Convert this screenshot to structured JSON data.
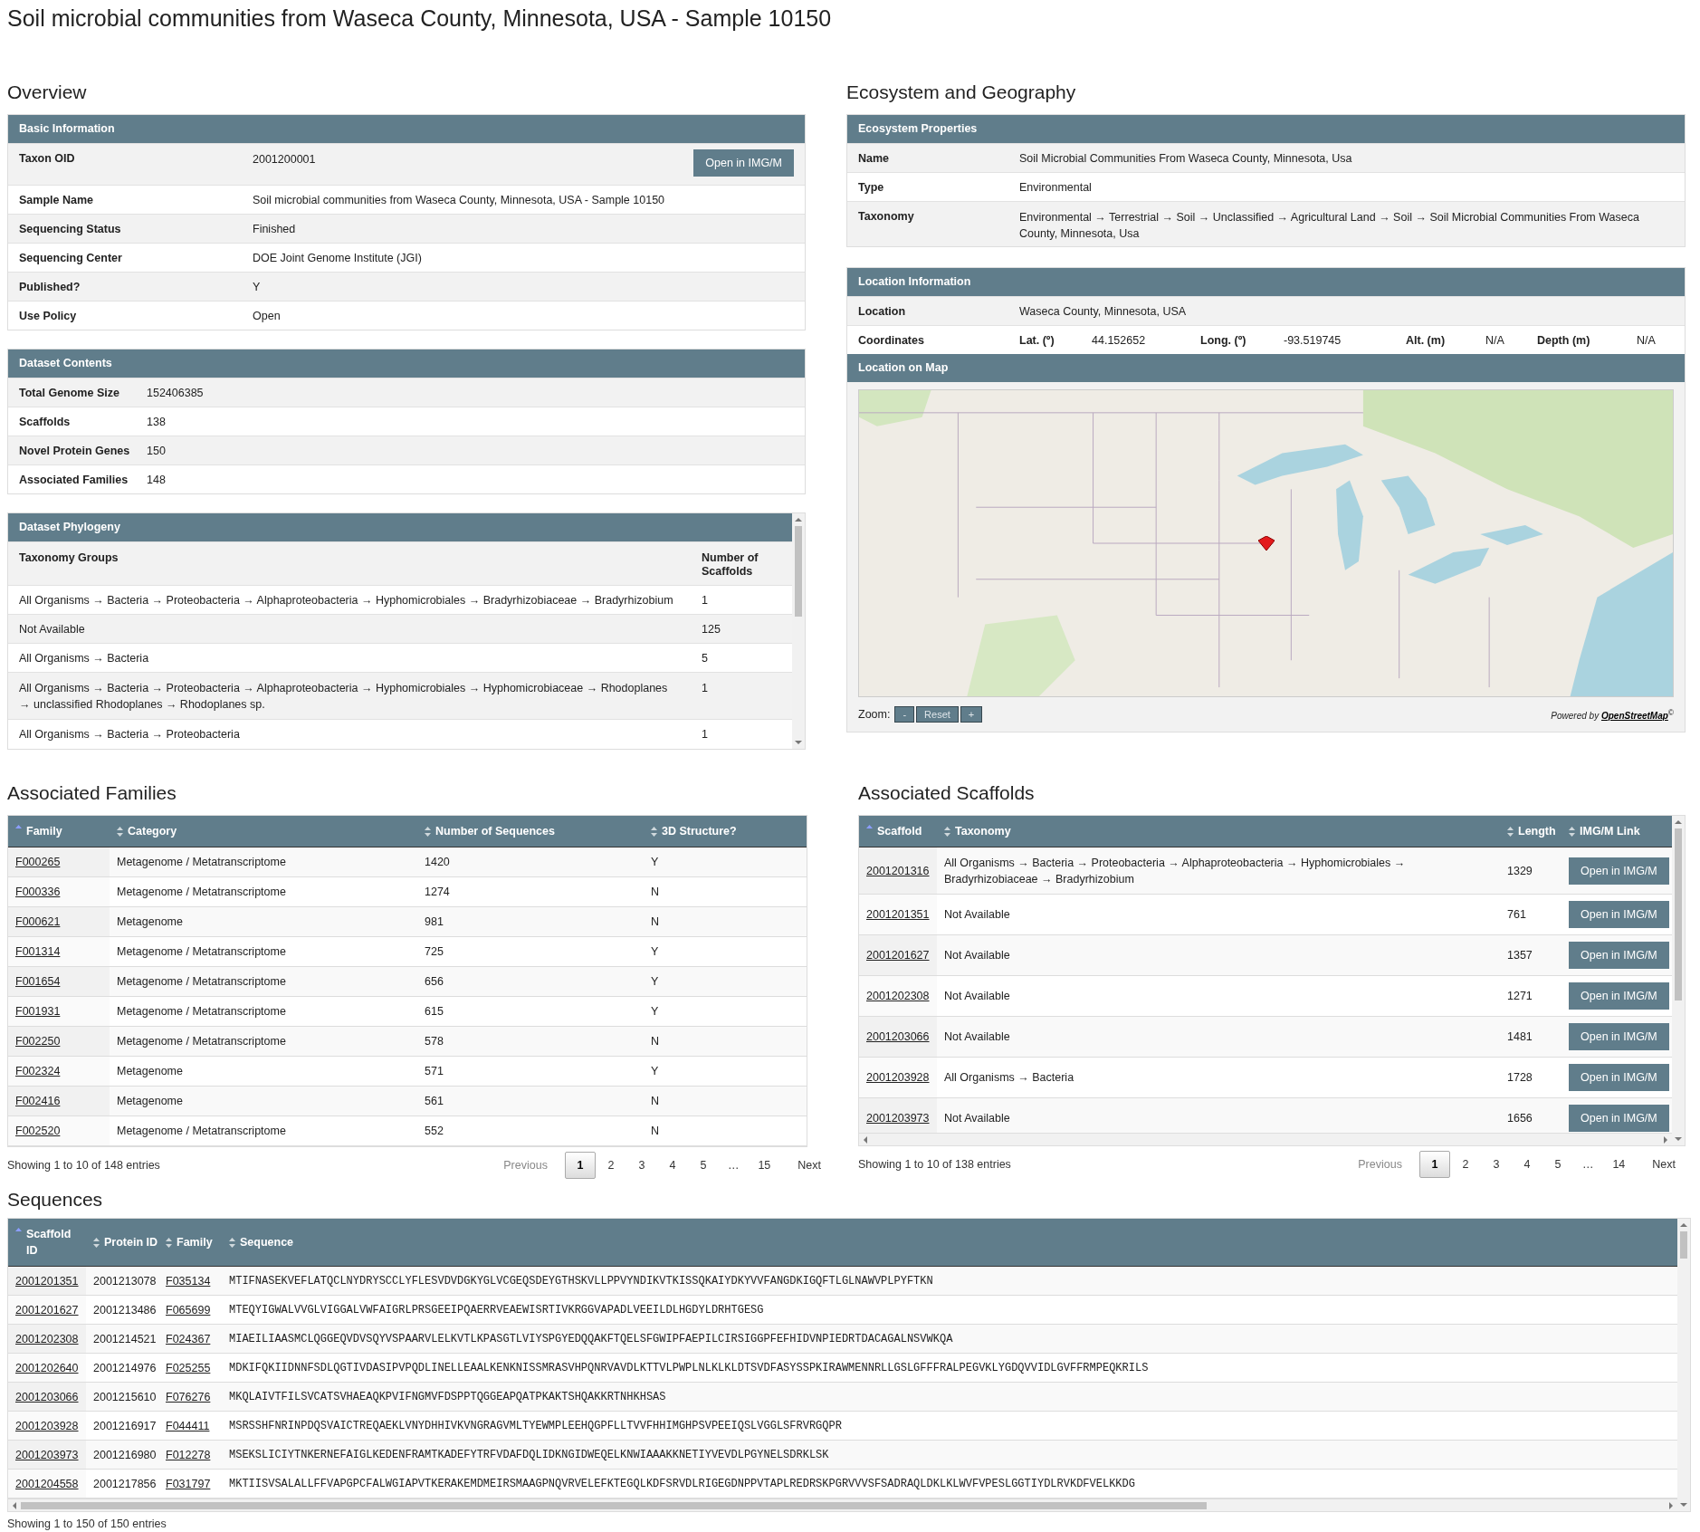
{
  "page_title": "Soil microbial communities from Waseca County, Minnesota, USA - Sample 10150",
  "overview": {
    "heading": "Overview",
    "basic_information": {
      "title": "Basic Information",
      "button": "Open in IMG/M",
      "rows": [
        {
          "label": "Taxon OID",
          "value": "2001200001"
        },
        {
          "label": "Sample Name",
          "value": "Soil microbial communities from Waseca County, Minnesota, USA - Sample 10150"
        },
        {
          "label": "Sequencing Status",
          "value": "Finished"
        },
        {
          "label": "Sequencing Center",
          "value": "DOE Joint Genome Institute (JGI)"
        },
        {
          "label": "Published?",
          "value": "Y"
        },
        {
          "label": "Use Policy",
          "value": "Open"
        }
      ]
    },
    "dataset_contents": {
      "title": "Dataset Contents",
      "rows": [
        {
          "label": "Total Genome Size",
          "value": "152406385"
        },
        {
          "label": "Scaffolds",
          "value": "138"
        },
        {
          "label": "Novel Protein Genes",
          "value": "150"
        },
        {
          "label": "Associated Families",
          "value": "148"
        }
      ]
    },
    "dataset_phylogeny": {
      "title": "Dataset Phylogeny",
      "columns": [
        "Taxonomy Groups",
        "Number of Scaffolds"
      ],
      "rows": [
        {
          "taxonomy": "All Organisms → Bacteria → Proteobacteria → Alphaproteobacteria → Hyphomicrobiales → Bradyrhizobiaceae → Bradyrhizobium",
          "count": "1"
        },
        {
          "taxonomy": "Not Available",
          "count": "125"
        },
        {
          "taxonomy": "All Organisms → Bacteria",
          "count": "5"
        },
        {
          "taxonomy": "All Organisms → Bacteria → Proteobacteria → Alphaproteobacteria → Hyphomicrobiales → Hyphomicrobiaceae → Rhodoplanes → unclassified Rhodoplanes → Rhodoplanes sp.",
          "count": "1"
        },
        {
          "taxonomy": "All Organisms → Bacteria → Proteobacteria",
          "count": "1"
        }
      ]
    }
  },
  "ecosystem_and_geography": {
    "heading": "Ecosystem and Geography",
    "ecosystem_properties": {
      "title": "Ecosystem Properties",
      "rows": [
        {
          "label": "Name",
          "value": "Soil Microbial Communities From Waseca County, Minnesota, Usa"
        },
        {
          "label": "Type",
          "value": "Environmental"
        },
        {
          "label": "Taxonomy",
          "value": "Environmental → Terrestrial → Soil → Unclassified → Agricultural Land → Soil → Soil Microbial Communities From Waseca County, Minnesota, Usa"
        }
      ]
    },
    "location_information": {
      "title": "Location Information",
      "rows": [
        {
          "label": "Location",
          "value": "Waseca County, Minnesota, USA"
        }
      ],
      "coordinates": {
        "label": "Coordinates",
        "fields": [
          {
            "label": "Lat. (º)",
            "value": "44.152652"
          },
          {
            "label": "Long. (º)",
            "value": "-93.519745"
          },
          {
            "label": "Alt. (m)",
            "value": "N/A"
          },
          {
            "label": "Depth (m)",
            "value": "N/A"
          }
        ]
      }
    },
    "map": {
      "title": "Location on Map",
      "zoom_label": "Zoom:",
      "zoom_buttons": [
        "-",
        "Reset",
        "+"
      ],
      "credit": "Powered by",
      "credit_link": "OpenStreetMap",
      "credit_mark": "©"
    }
  },
  "associated_families": {
    "heading": "Associated Families",
    "columns": [
      {
        "label": "Family",
        "sorted": true
      },
      {
        "label": "Category",
        "sorted": false
      },
      {
        "label": "Number of Sequences",
        "sorted": false
      },
      {
        "label": "3D Structure?",
        "sorted": false
      }
    ],
    "rows": [
      {
        "family": "F000265",
        "category": "Metagenome / Metatranscriptome",
        "sequences": "1420",
        "structure": "Y"
      },
      {
        "family": "F000336",
        "category": "Metagenome / Metatranscriptome",
        "sequences": "1274",
        "structure": "N"
      },
      {
        "family": "F000621",
        "category": "Metagenome",
        "sequences": "981",
        "structure": "N"
      },
      {
        "family": "F001314",
        "category": "Metagenome / Metatranscriptome",
        "sequences": "725",
        "structure": "Y"
      },
      {
        "family": "F001654",
        "category": "Metagenome / Metatranscriptome",
        "sequences": "656",
        "structure": "Y"
      },
      {
        "family": "F001931",
        "category": "Metagenome / Metatranscriptome",
        "sequences": "615",
        "structure": "Y"
      },
      {
        "family": "F002250",
        "category": "Metagenome / Metatranscriptome",
        "sequences": "578",
        "structure": "N"
      },
      {
        "family": "F002324",
        "category": "Metagenome",
        "sequences": "571",
        "structure": "Y"
      },
      {
        "family": "F002416",
        "category": "Metagenome",
        "sequences": "561",
        "structure": "N"
      },
      {
        "family": "F002520",
        "category": "Metagenome / Metatranscriptome",
        "sequences": "552",
        "structure": "N"
      }
    ],
    "info": "Showing 1 to 10 of 148 entries",
    "pagination": {
      "previous": {
        "label": "Previous",
        "disabled": true
      },
      "next": {
        "label": "Next",
        "disabled": false
      },
      "pages": [
        {
          "label": "1",
          "kind": "page",
          "selected": true
        },
        {
          "label": "2",
          "kind": "page",
          "selected": false
        },
        {
          "label": "3",
          "kind": "page",
          "selected": false
        },
        {
          "label": "4",
          "kind": "page",
          "selected": false
        },
        {
          "label": "5",
          "kind": "page",
          "selected": false
        },
        {
          "label": "…",
          "kind": "ellipsis"
        },
        {
          "label": "15",
          "kind": "page",
          "selected": false
        }
      ]
    }
  },
  "associated_scaffolds": {
    "heading": "Associated Scaffolds",
    "columns": [
      {
        "label": "Scaffold",
        "sorted": true
      },
      {
        "label": "Taxonomy",
        "sorted": false
      },
      {
        "label": "Length",
        "sorted": false
      },
      {
        "label": "IMG/M Link",
        "sorted": false
      }
    ],
    "rows": [
      {
        "scaffold": "2001201316",
        "taxonomy": "All Organisms → Bacteria → Proteobacteria → Alphaproteobacteria → Hyphomicrobiales → Bradyrhizobiaceae → Bradyrhizobium",
        "length": "1329",
        "button": "Open in IMG/M"
      },
      {
        "scaffold": "2001201351",
        "taxonomy": "Not Available",
        "length": "761",
        "button": "Open in IMG/M"
      },
      {
        "scaffold": "2001201627",
        "taxonomy": "Not Available",
        "length": "1357",
        "button": "Open in IMG/M"
      },
      {
        "scaffold": "2001202308",
        "taxonomy": "Not Available",
        "length": "1271",
        "button": "Open in IMG/M"
      },
      {
        "scaffold": "2001203066",
        "taxonomy": "Not Available",
        "length": "1481",
        "button": "Open in IMG/M"
      },
      {
        "scaffold": "2001203928",
        "taxonomy": "All Organisms → Bacteria",
        "length": "1728",
        "button": "Open in IMG/M"
      },
      {
        "scaffold": "2001203973",
        "taxonomy": "Not Available",
        "length": "1656",
        "button": "Open in IMG/M"
      }
    ],
    "info": "Showing 1 to 10 of 138 entries",
    "pagination": {
      "previous": {
        "label": "Previous",
        "disabled": true
      },
      "next": {
        "label": "Next",
        "disabled": false
      },
      "pages": [
        {
          "label": "1",
          "kind": "page",
          "selected": true
        },
        {
          "label": "2",
          "kind": "page",
          "selected": false
        },
        {
          "label": "3",
          "kind": "page",
          "selected": false
        },
        {
          "label": "4",
          "kind": "page",
          "selected": false
        },
        {
          "label": "5",
          "kind": "page",
          "selected": false
        },
        {
          "label": "…",
          "kind": "ellipsis"
        },
        {
          "label": "14",
          "kind": "page",
          "selected": false
        }
      ]
    }
  },
  "sequences": {
    "heading": "Sequences",
    "columns": [
      {
        "label": "Scaffold ID",
        "sorted": true
      },
      {
        "label": "Protein ID",
        "sorted": false
      },
      {
        "label": "Family",
        "sorted": false
      },
      {
        "label": "Sequence",
        "sorted": false
      }
    ],
    "rows": [
      {
        "scaffold": "2001201351",
        "protein": "2001213078",
        "family": "F035134",
        "sequence": "MTIFNASEKVEFLATQCLNYDRYSCCLYFLESVDVDGKYGLVCGEQSDEYGTHSKVLLPPVYNDIKVTKISSQKAIYDKYVVFANGDKIGQFTLGLNAWVPLPYFTKN"
      },
      {
        "scaffold": "2001201627",
        "protein": "2001213486",
        "family": "F065699",
        "sequence": "MTEQYIGWALVVGLVIGGALVWFAIGRLPRSGEEIPQAERRVEAEWISRTIVKRGGVAPADLVEEILDLHGDYLDRHTGESG"
      },
      {
        "scaffold": "2001202308",
        "protein": "2001214521",
        "family": "F024367",
        "sequence": "MIAEILIAASMCLQGGEQVDVSQYVSPAARVLELKVTLKPASGTLVIYSPGYEDQQAKFTQELSFGWIPFAEPILCIRSIGGPFEFHIDVNPIEDRTDACAGALNSVWKQA"
      },
      {
        "scaffold": "2001202640",
        "protein": "2001214976",
        "family": "F025255",
        "sequence": "MDKIFQKIIDNNFSDLQGTIVDASIPVPQDLINELLEAALKENKNISSMRASVHPQNRVAVDLKTTVLPWPLNLKLKLDTSVDFASYSSPKIRAWMENNRLLGSLGFFFRALPEGVKLYGDQVVIDLGVFFRMPEQKRILS"
      },
      {
        "scaffold": "2001203066",
        "protein": "2001215610",
        "family": "F076276",
        "sequence": "MKQLAIVTFILSVCATSVHAEAQKPVIFNGMVFDSPPTQGGEAPQATPKAKTSHQAKKRTNHKHSAS"
      },
      {
        "scaffold": "2001203928",
        "protein": "2001216917",
        "family": "F044411",
        "sequence": "MSRSSHFNRINPDQSVAICTREQAEKLVNYDHHIVKVNGRAGVMLTYEWMPLEEHQGPFLLTVVFHHIMGHPSVPEEIQSLVGGLSFRVRGQPR"
      },
      {
        "scaffold": "2001203973",
        "protein": "2001216980",
        "family": "F012278",
        "sequence": "MSEKSLICIYTNKERNEFAIGLKEDENFRAMTKADEFYTRFVDAFDQLIDKNGIDWEQELKNWIAAAKKNETIYVEVDLPGYNELSDRKLSK"
      },
      {
        "scaffold": "2001204558",
        "protein": "2001217856",
        "family": "F031797",
        "sequence": "MKTIISVSALALLFFVAPGPCFALWGIAPVTKERAKEMDMEIRSMAAGPNQVRVELEFKTEGQLKDFSRVDLRIGEGDNPPVTAPLREDRSKPGRVVVSFSADRAQLDKLKLWVFVPESLGGTIYDLRVKDFVELKKDG"
      }
    ],
    "info": "Showing 1 to 150 of 150 entries"
  }
}
